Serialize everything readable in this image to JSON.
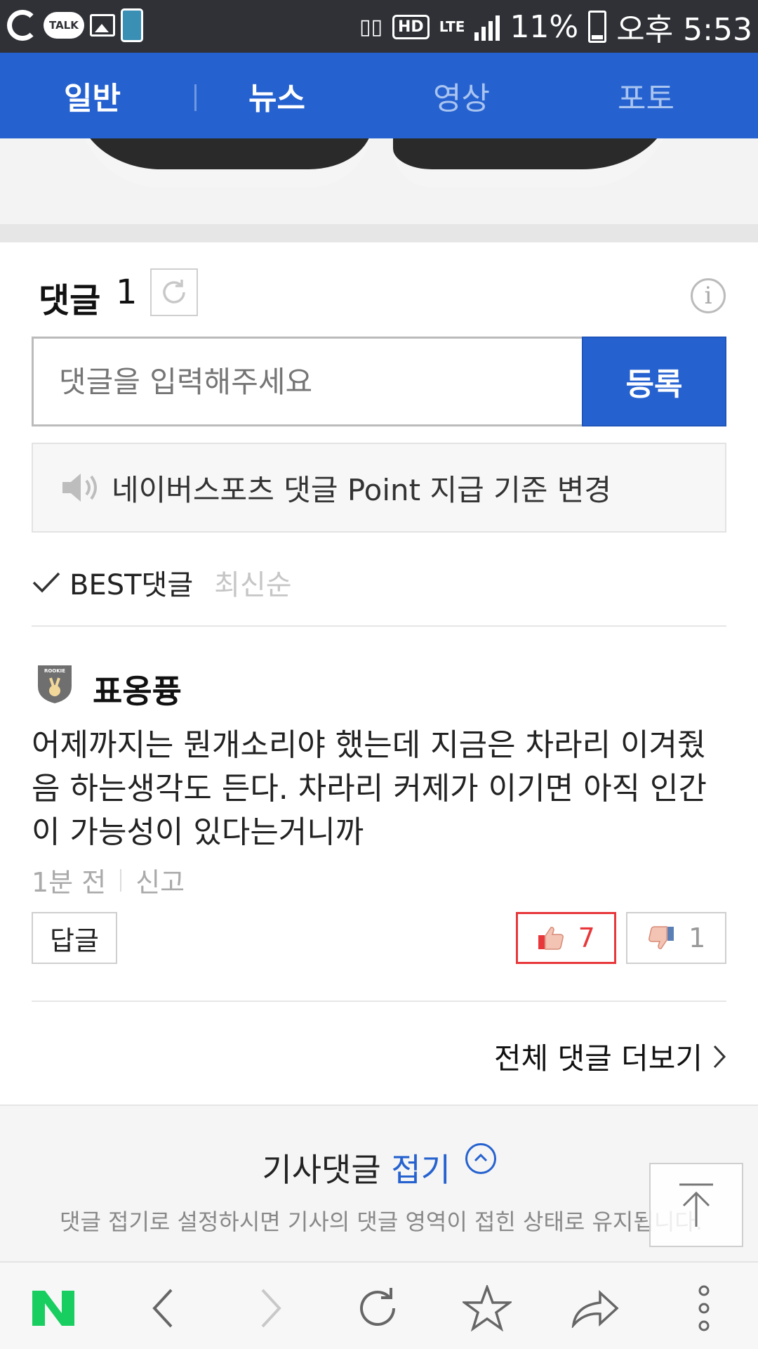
{
  "status_bar": {
    "talk_label": "TALK",
    "hd_label": "HD",
    "lte_label": "LTE",
    "battery": "11%",
    "time": "오후 5:53"
  },
  "top_nav": {
    "tabs": [
      {
        "label": "일반"
      },
      {
        "label": "뉴스"
      },
      {
        "label": "영상"
      },
      {
        "label": "포토"
      }
    ]
  },
  "comments": {
    "title": "댓글",
    "count": "1",
    "input_placeholder": "댓글을 입력해주세요",
    "submit_label": "등록",
    "notice": "네이버스포츠 댓글 Point 지급 기준 변경",
    "sort_best": "BEST댓글",
    "sort_latest": "최신순",
    "items": [
      {
        "author": "표옹퓽",
        "badge_text": "ROOKIE",
        "text": "어제까지는 뭔개소리야 했는데 지금은 차라리 이겨줬음 하는생각도 든다. 차라리 커제가 이기면 아직 인간이 가능성이 있다는거니까",
        "time": "1분 전",
        "report": "신고",
        "reply_label": "답글",
        "likes": "7",
        "dislikes": "1"
      }
    ],
    "more_label": "전체 댓글 더보기"
  },
  "fold": {
    "title": "기사댓글",
    "action": "접기",
    "desc": "댓글 접기로 설정하시면 기사의 댓글 영역이 접힌 상태로 유지됩니다."
  },
  "bottom_bar": {
    "icons": [
      "naver-logo",
      "back-icon",
      "forward-icon",
      "reload-icon",
      "star-icon",
      "share-icon",
      "more-icon"
    ],
    "logo_letter": "N",
    "logo_color": "#19ce60"
  },
  "colors": {
    "brand_blue": "#2662cf",
    "like_red": "#e8373a"
  }
}
